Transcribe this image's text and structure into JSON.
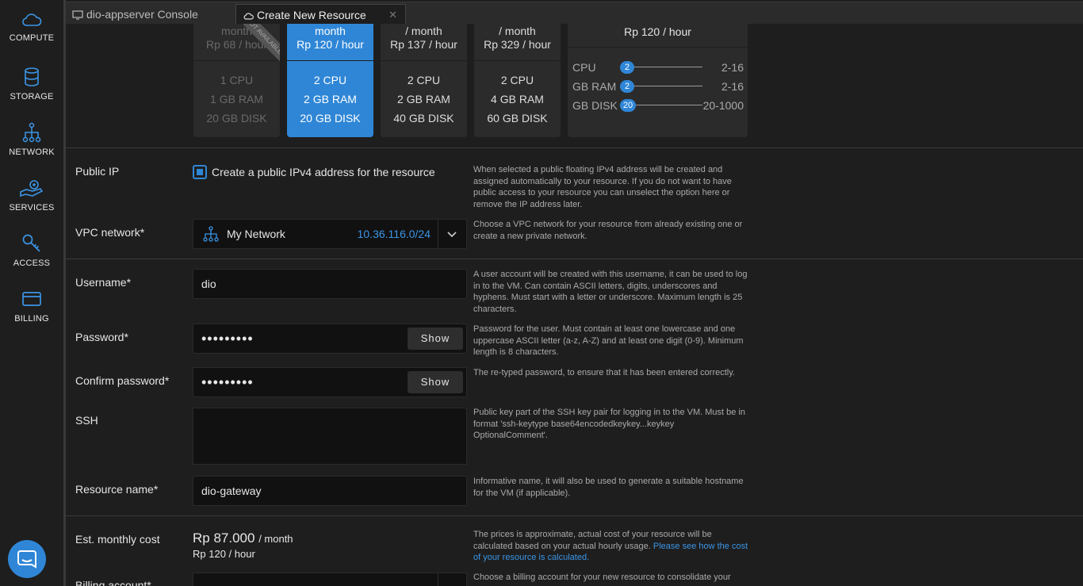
{
  "sidebar": {
    "items": [
      {
        "label": "COMPUTE",
        "icon": "cloud-icon"
      },
      {
        "label": "STORAGE",
        "icon": "database-icon"
      },
      {
        "label": "NETWORK",
        "icon": "network-icon"
      },
      {
        "label": "SERVICES",
        "icon": "services-hand-icon"
      },
      {
        "label": "ACCESS",
        "icon": "key-icon"
      },
      {
        "label": "BILLING",
        "icon": "credit-card-icon"
      }
    ]
  },
  "tabs": [
    {
      "label": "dio-appserver Console",
      "icon": "monitor-icon"
    },
    {
      "label": "Create New Resource",
      "icon": "cloud-icon"
    }
  ],
  "plans": [
    {
      "month": "month",
      "hour": "Rp 68 / hour",
      "cpu": "1 CPU",
      "ram": "1 GB RAM",
      "disk": "20 GB DISK",
      "state": "disabled",
      "ribbon": "NOT AVAILABLE"
    },
    {
      "month": "month",
      "hour": "Rp 120 / hour",
      "cpu": "2 CPU",
      "ram": "2 GB RAM",
      "disk": "20 GB DISK",
      "state": "selected"
    },
    {
      "month": "/ month",
      "hour": "Rp 137 / hour",
      "cpu": "2 CPU",
      "ram": "2 GB RAM",
      "disk": "40 GB DISK",
      "state": "normal"
    },
    {
      "month": "/ month",
      "hour": "Rp 329 / hour",
      "cpu": "2 CPU",
      "ram": "4 GB RAM",
      "disk": "60 GB DISK",
      "state": "normal"
    }
  ],
  "custom": {
    "hour": "Rp 120 / hour",
    "sliders": [
      {
        "name": "CPU",
        "value": "2",
        "range": "2-16",
        "fraction": 0
      },
      {
        "name": "GB RAM",
        "value": "2",
        "range": "2-16",
        "fraction": 0
      },
      {
        "name": "GB DISK",
        "value": "20",
        "range": "20-1000",
        "fraction": 0
      }
    ]
  },
  "public_ip": {
    "label": "Public IP",
    "checkbox_label": "Create a public IPv4 address for the resource",
    "checked": true,
    "help": "When selected a public floating IPv4 address will be created and assigned automatically to your resource. If you do not want to have public access to your resource you can unselect the option here or remove the IP address later."
  },
  "vpc": {
    "label": "VPC network*",
    "name": "My Network",
    "cidr": "10.36.116.0/24",
    "help": "Choose a VPC network for your resource from already existing one or create a new private network."
  },
  "username": {
    "label": "Username*",
    "value": "dio",
    "help": "A user account will be created with this username, it can be used to log in to the VM. Can contain ASCII letters, digits, underscores and hyphens. Must start with a letter or underscore. Maximum length is 25 characters."
  },
  "password": {
    "label": "Password*",
    "value": "•••••••••",
    "show": "Show",
    "help": "Password for the user. Must contain at least one lowercase and one uppercase ASCII letter (a-z, A-Z) and at least one digit (0-9). Minimum length is 8 characters."
  },
  "confirm_password": {
    "label": "Confirm password*",
    "value": "•••••••••",
    "show": "Show",
    "help": "The re-typed password, to ensure that it has been entered correctly."
  },
  "ssh": {
    "label": "SSH",
    "value": "",
    "help": "Public key part of the SSH key pair for logging in to the VM. Must be in format 'ssh-keytype base64encodedkeykey...keykey OptionalComment'."
  },
  "resource_name": {
    "label": "Resource name*",
    "value": "dio-gateway",
    "help": "Informative name, it will also be used to generate a suitable hostname for the VM (if applicable)."
  },
  "cost": {
    "label": "Est. monthly cost",
    "monthly": "Rp 87.000",
    "per_month": "/ month",
    "hourly": "Rp 120 / hour",
    "help": "The prices is approximate, actual cost of your resource will be calculated based on your actual hourly usage.",
    "help_link": "Please see how the cost of your resource is calculated."
  },
  "billing": {
    "label": "Billing account*",
    "help": "Choose a billing account for your new resource to consolidate your"
  },
  "colors": {
    "accent": "#2f86d6",
    "link": "#3b95e6",
    "background": "#1e1e1e",
    "panel": "#2b2b2b"
  }
}
